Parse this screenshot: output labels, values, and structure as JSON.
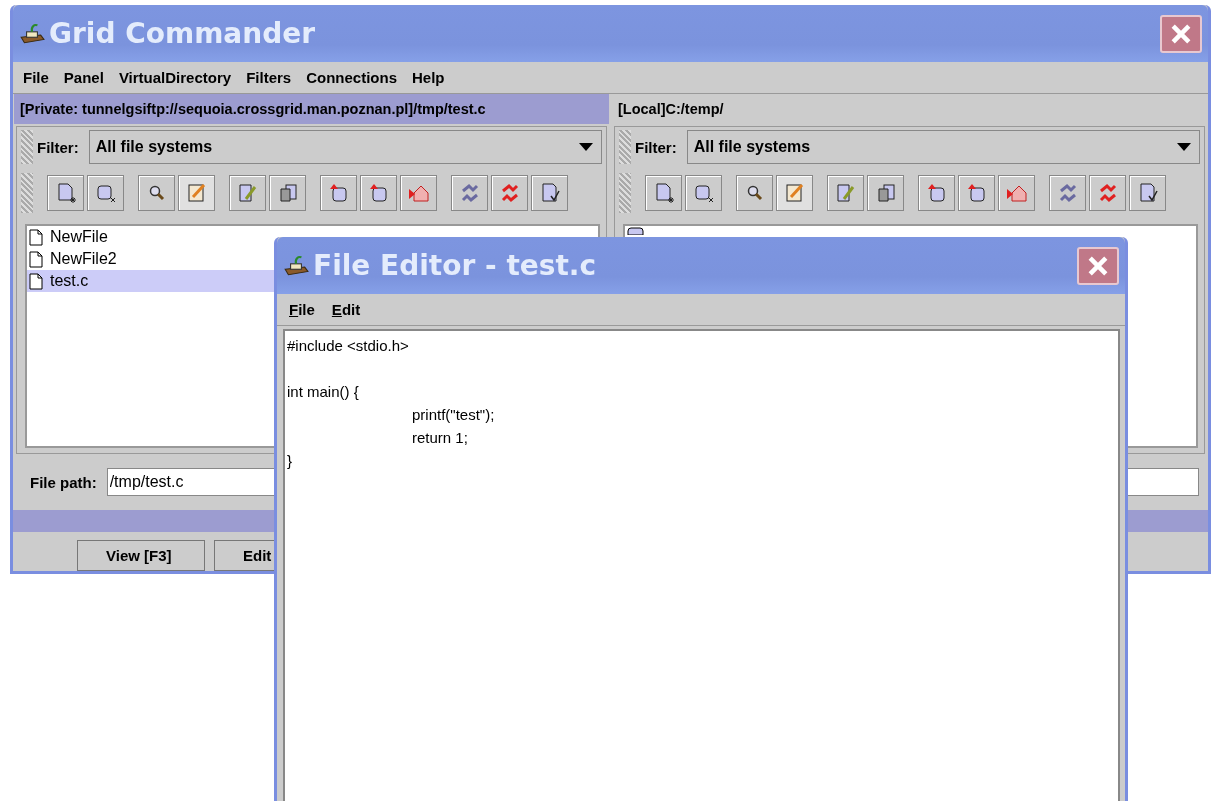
{
  "main_window": {
    "title": "Grid Commander",
    "menu": [
      "File",
      "Panel",
      "VirtualDirectory",
      "Filters",
      "Connections",
      "Help"
    ],
    "panels": [
      {
        "path": "[Private: tunnelgsiftp://sequoia.crossgrid.man.poznan.pl]/tmp/test.c",
        "active": true,
        "filter_label": "Filter:",
        "filter_value": "All file systems",
        "files": [
          {
            "name": "NewFile",
            "kind": "file",
            "selected": false
          },
          {
            "name": "NewFile2",
            "kind": "file",
            "selected": false
          },
          {
            "name": "test.c",
            "kind": "file",
            "selected": true
          }
        ],
        "file_path_label": "File path:",
        "file_path_value": "/tmp/test.c"
      },
      {
        "path": "[Local]C:/temp/",
        "active": false,
        "filter_label": "Filter:",
        "filter_value": "All file systems",
        "files": [
          {
            "kind": "folder",
            "selected": false
          }
        ]
      }
    ],
    "buttons": [
      "View [F3]",
      "Edit"
    ]
  },
  "editor_window": {
    "title": "File Editor - test.c",
    "menu": [
      "File",
      "Edit"
    ],
    "text": "#include <stdio.h>\n\nint main() {\n\tprintf(\"test\");\n\treturn 1;\n}"
  }
}
